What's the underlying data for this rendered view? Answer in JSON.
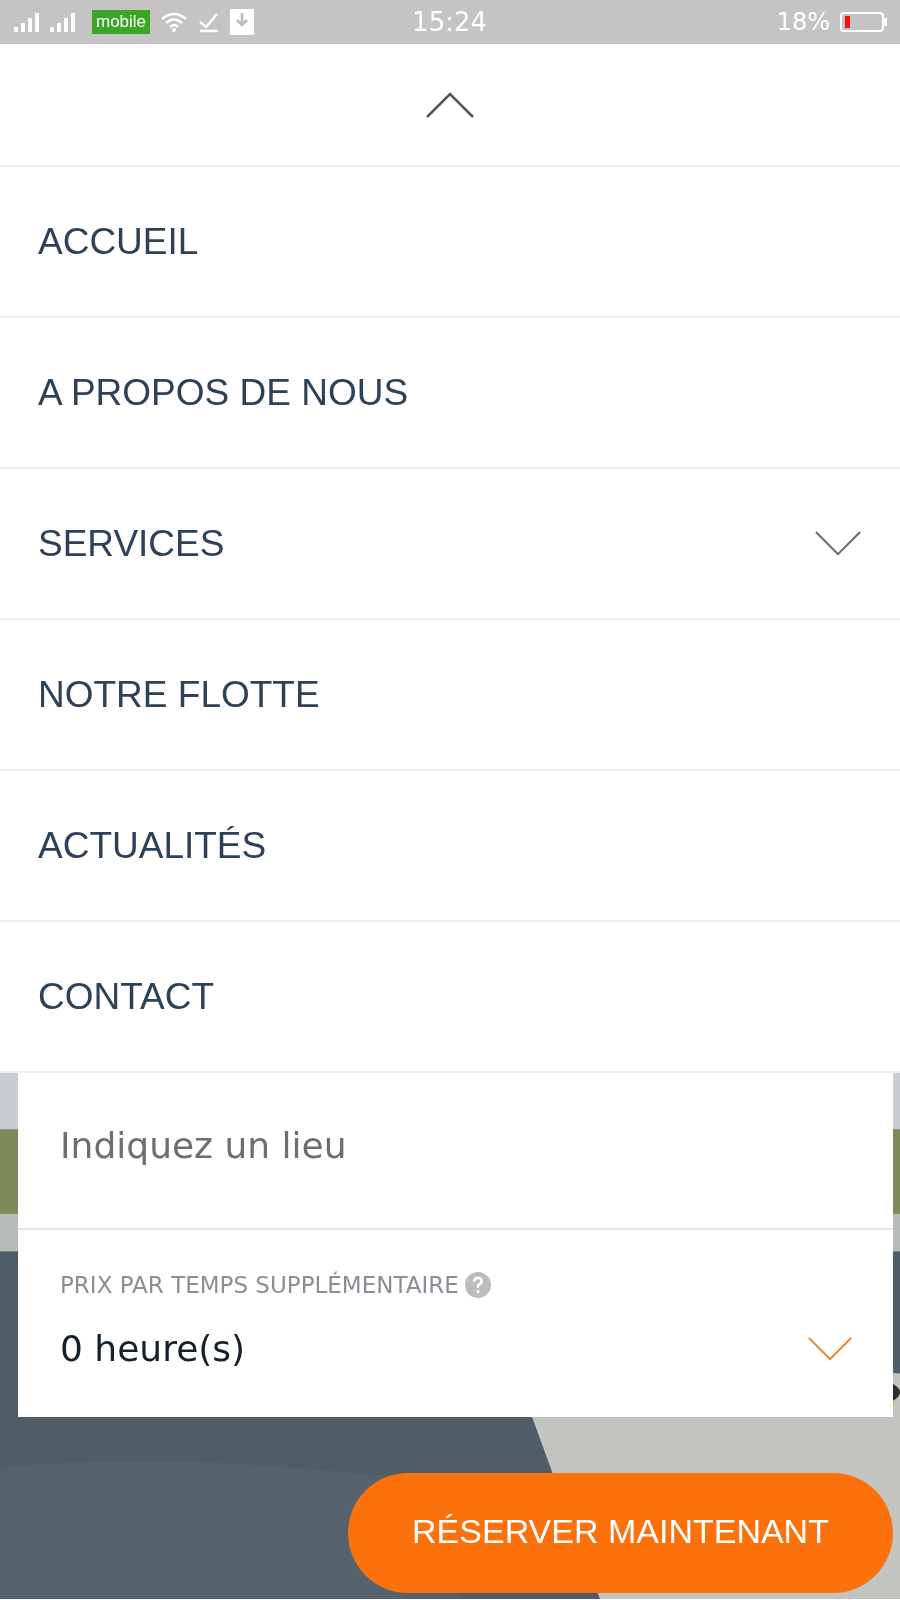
{
  "status_bar": {
    "carrier_badge": "mobile",
    "time": "15:24",
    "battery": "18%"
  },
  "menu": {
    "items": [
      {
        "label": "ACCUEIL",
        "has_submenu": false
      },
      {
        "label": "A PROPOS DE NOUS",
        "has_submenu": false
      },
      {
        "label": "SERVICES",
        "has_submenu": true
      },
      {
        "label": "NOTRE FLOTTE",
        "has_submenu": false
      },
      {
        "label": "ACTUALITÉS",
        "has_submenu": false
      },
      {
        "label": "CONTACT",
        "has_submenu": false
      }
    ]
  },
  "form": {
    "location_field": {
      "placeholder": "Indiquez un lieu"
    },
    "extra_time": {
      "label": "PRIX PAR TEMPS SUPPLÉMENTAIRE",
      "value": "0 heure(s)"
    }
  },
  "book_button": "RÉSERVER MAINTENANT"
}
